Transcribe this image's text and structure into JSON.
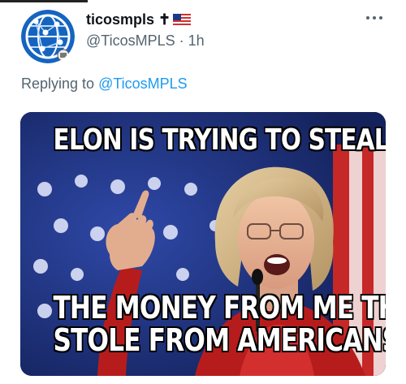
{
  "tweet": {
    "display_name": "ticosmpls ✝",
    "handle": "@TicosMPLS",
    "separator": " · ",
    "time": "1h",
    "replying_prefix": "Replying to ",
    "replying_to": "@TicosMPLS"
  },
  "media": {
    "caption_top": "ELON IS TRYING TO STEAL",
    "caption_bottom_line1": "THE MONEY FROM ME THAT I",
    "caption_bottom_line2": "STOLE FROM AMERICANS!"
  },
  "icons": {
    "avatar": "globe-network-icon",
    "badge": "us-flag-icon",
    "more": "more-horizontal-icon"
  },
  "colors": {
    "text_primary": "#0f1419",
    "text_secondary": "#536471",
    "link": "#1d9bf0",
    "avatar_blue": "#1565c0"
  }
}
